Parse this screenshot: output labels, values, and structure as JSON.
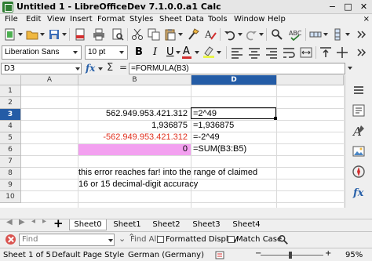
{
  "window": {
    "title": "Untitled 1 - LibreOfficeDev 7.1.0.0.a1 Calc",
    "min_glyph": "−",
    "max_glyph": "□",
    "close_glyph": "✕"
  },
  "menu": {
    "items": [
      "File",
      "Edit",
      "View",
      "Insert",
      "Format",
      "Styles",
      "Sheet",
      "Data",
      "Tools",
      "Window",
      "Help"
    ],
    "close_glyph": "×"
  },
  "format_toolbar": {
    "font_name": "Liberation Sans",
    "font_size": "10 pt",
    "bold_label": "B",
    "italic_label": "I",
    "underline_label": "U",
    "font_color_label": "A"
  },
  "formula_bar": {
    "cell_ref": "D3",
    "fx_label": "fx",
    "sum_glyph": "Σ",
    "equals_glyph": "=",
    "formula": "=FORMULA(B3)"
  },
  "grid": {
    "columns": [
      "A",
      "B",
      "C",
      "D"
    ],
    "active_column": "D",
    "rows": [
      "1",
      "2",
      "3",
      "4",
      "5",
      "6",
      "7",
      "8",
      "9",
      "10"
    ],
    "active_row": "3",
    "cells": {
      "B3": "562.949.953.421.312",
      "B4": "1,936875",
      "B5": "-562.949.953.421.312",
      "B6": "0",
      "D3": "=2^49",
      "D4": "=1,936875",
      "D5": "=-2^49",
      "D6": "=SUM(B3:B5)",
      "B8": "this error reaches far! into the range of claimed",
      "B9": "16 or 15 decimal-digit accuracy"
    },
    "colors": {
      "negative_text": "#e0301e",
      "highlight_fill": "#f3a0f0",
      "header_active": "#245ca6"
    }
  },
  "sheets": {
    "add_glyph": "+",
    "tabs": [
      "Sheet0",
      "Sheet1",
      "Sheet2",
      "Sheet3",
      "Sheet4"
    ],
    "active": "Sheet0"
  },
  "find": {
    "placeholder": "Find",
    "find_all": "Find All",
    "formatted_display": "Formatted Display",
    "match_case": "Match Case"
  },
  "status": {
    "sheet_info": "Sheet 1 of 5",
    "page_style": "Default Page Style",
    "language": "German (Germany)",
    "zoom": "95%",
    "zoom_minus": "−",
    "zoom_plus": "+"
  }
}
